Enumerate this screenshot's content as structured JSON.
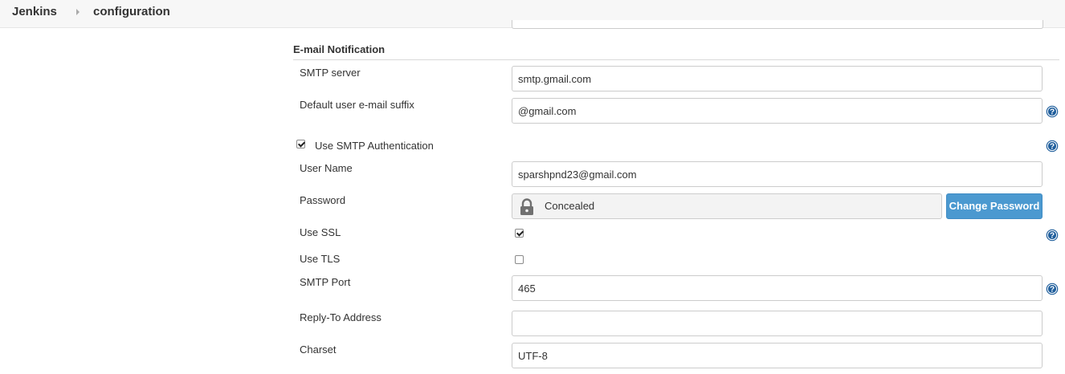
{
  "breadcrumb": {
    "root": "Jenkins",
    "current": "configuration"
  },
  "section": {
    "title": "E-mail Notification"
  },
  "fields": {
    "smtp_server": {
      "label": "SMTP server",
      "value": "smtp.gmail.com"
    },
    "default_suffix": {
      "label": "Default user e-mail suffix",
      "value": "@gmail.com"
    },
    "use_smtp_auth": {
      "label": "Use SMTP Authentication",
      "checked": true
    },
    "user_name": {
      "label": "User Name",
      "value": "sparshpnd23@gmail.com"
    },
    "password": {
      "label": "Password",
      "display": "Concealed",
      "button_label": "Change Password"
    },
    "use_ssl": {
      "label": "Use SSL",
      "checked": true
    },
    "use_tls": {
      "label": "Use TLS",
      "checked": false
    },
    "smtp_port": {
      "label": "SMTP Port",
      "value": "465"
    },
    "reply_to": {
      "label": "Reply-To Address",
      "value": ""
    },
    "charset": {
      "label": "Charset",
      "value": "UTF-8"
    }
  },
  "icons": {
    "help": "help-icon",
    "lock": "lock-icon",
    "breadcrumb_separator": "chevron-right-icon"
  },
  "colors": {
    "accent_button": "#4b99d0",
    "help_icon": "#1f5e9c",
    "breadcrumb_bar": "#f7f7f7"
  }
}
